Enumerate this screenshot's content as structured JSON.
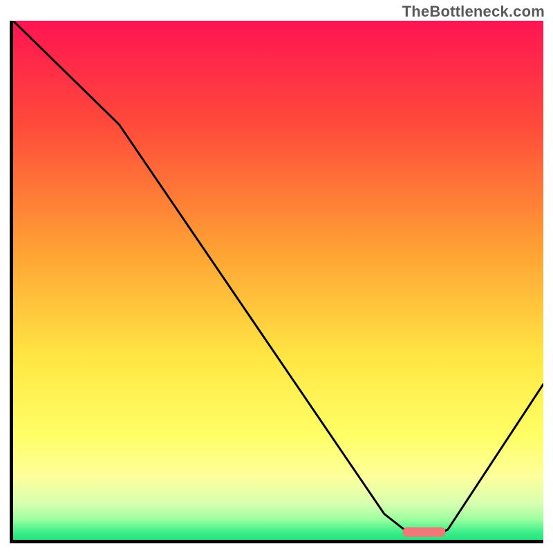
{
  "watermark": "TheBottleneck.com",
  "chart_data": {
    "type": "line",
    "title": "",
    "xlabel": "",
    "ylabel": "",
    "xlim": [
      0,
      100
    ],
    "ylim": [
      0,
      100
    ],
    "x": [
      0,
      20,
      70,
      75,
      80,
      82,
      100
    ],
    "values": [
      100,
      80,
      5,
      1,
      1,
      2,
      30
    ],
    "annotations": [
      {
        "kind": "marker",
        "shape": "rounded-bar",
        "x_center": 77.5,
        "y": 1.5,
        "color": "#f07878"
      }
    ],
    "background_gradient": {
      "stops": [
        {
          "offset": 0.0,
          "color": "#ff1452"
        },
        {
          "offset": 0.2,
          "color": "#ff4a3a"
        },
        {
          "offset": 0.45,
          "color": "#ffa434"
        },
        {
          "offset": 0.65,
          "color": "#ffe744"
        },
        {
          "offset": 0.8,
          "color": "#ffff66"
        },
        {
          "offset": 0.88,
          "color": "#fdff9c"
        },
        {
          "offset": 0.93,
          "color": "#d7ffb0"
        },
        {
          "offset": 0.96,
          "color": "#9effa0"
        },
        {
          "offset": 0.985,
          "color": "#3cf08a"
        },
        {
          "offset": 1.0,
          "color": "#28e07a"
        }
      ]
    }
  }
}
